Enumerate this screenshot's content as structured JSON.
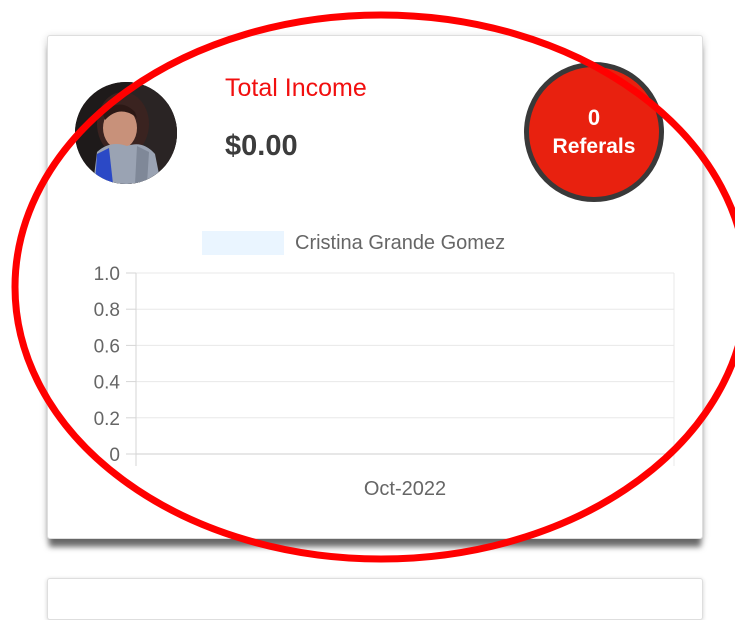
{
  "income": {
    "label": "Total Income",
    "value": "$0.00"
  },
  "avatar": {
    "icon": "user-photo"
  },
  "referrals": {
    "count": "0",
    "label": "Referals"
  },
  "colors": {
    "accent_red": "#f10f0f",
    "referral_circle": "#e8210f",
    "series_fill": "#eaf5ff",
    "annotation_red": "#ff0000"
  },
  "chart_data": {
    "type": "bar",
    "categories": [
      "Oct-2022"
    ],
    "series": [
      {
        "name": "Cristina Grande Gomez",
        "values": [
          0
        ]
      }
    ],
    "yticks": [
      "1.0",
      "0.8",
      "0.6",
      "0.4",
      "0.2",
      "0"
    ],
    "ylim": [
      0,
      1
    ],
    "grid": true,
    "legend": "top-center"
  }
}
